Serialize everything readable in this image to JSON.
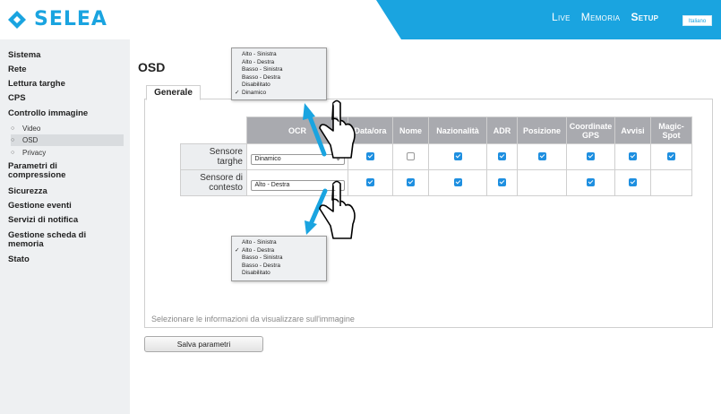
{
  "brand": {
    "name": "SELEA",
    "color": "#1aa4e0"
  },
  "nav": {
    "items": [
      "Live",
      "Memoria",
      "Setup"
    ],
    "active": "Setup",
    "language": "Italiano"
  },
  "sidebar": {
    "items": {
      "sistema": "Sistema",
      "rete": "Rete",
      "lettura": "Lettura targhe",
      "cps": "CPS",
      "controllo": "Controllo immagine",
      "video": "Video",
      "osd": "OSD",
      "privacy": "Privacy",
      "parametri1": "Parametri di",
      "parametri2": "compressione",
      "sicurezza": "Sicurezza",
      "eventi": "Gestione eventi",
      "servizi": "Servizi di notifica",
      "scheda1": "Gestione scheda di",
      "scheda2": "memoria",
      "stato": "Stato"
    },
    "selected": "OSD"
  },
  "page": {
    "title": "OSD",
    "tab": "Generale",
    "hint": "Selezionare le informazioni da visualizzare sull'immagine",
    "save": "Salva parametri"
  },
  "table": {
    "columns": [
      "OCR",
      "Data/ora",
      "Nome",
      "Nazionalità",
      "ADR",
      "Posizione",
      "Coordinate GPS",
      "Avvisi",
      "Magic-Spot"
    ],
    "rows": [
      {
        "label1": "Sensore",
        "label2": "targhe",
        "ocr": "Dinamico",
        "checks": [
          true,
          false,
          true,
          true,
          true,
          true,
          true,
          true
        ]
      },
      {
        "label1": "Sensore di",
        "label2": "contesto",
        "ocr": "Alto - Destra",
        "checks": [
          true,
          true,
          true,
          true,
          null,
          true,
          true,
          null
        ]
      }
    ]
  },
  "popup_top": {
    "options": [
      "Alto - Sinistra",
      "Alto - Destra",
      "Basso - Sinistra",
      "Basso - Destra",
      "Disabilitato",
      "Dinamico"
    ],
    "selected": "Dinamico"
  },
  "popup_bottom": {
    "options": [
      "Alto - Sinistra",
      "Alto - Destra",
      "Basso - Sinistra",
      "Basso - Destra",
      "Disabilitato"
    ],
    "selected": "Alto - Destra"
  },
  "colors": {
    "banner": "#1aa4e0",
    "checkbox": "#1e8fe0",
    "arrow": "#1aa4e0",
    "header_cell": "#a9aaaf"
  },
  "icons": {
    "logo": "selea-chevron-icon",
    "pointer": "hand-pointer-icon",
    "arrow": "arrow-icon"
  }
}
